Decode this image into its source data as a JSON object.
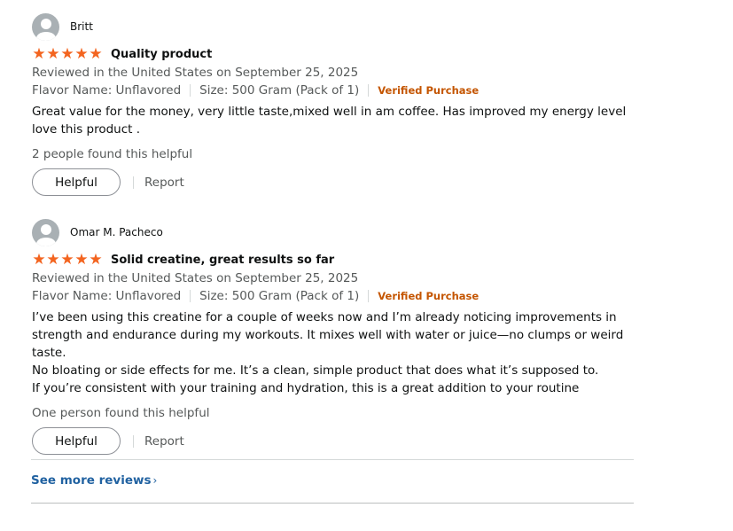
{
  "reviews": [
    {
      "name": "Britt",
      "rating": 5,
      "title": "Quality product",
      "date": "Reviewed in the United States on September 25, 2025",
      "flavor": "Flavor Name: Unflavored",
      "size": "Size: 500 Gram (Pack of 1)",
      "verified": "Verified Purchase",
      "body": [
        "Great value for the money, very little taste,mixed well in am coffee. Has improved my energy level love this product ."
      ],
      "helpful_count": "2 people found this helpful",
      "helpful_label": "Helpful",
      "report_label": "Report"
    },
    {
      "name": "Omar M. Pacheco",
      "rating": 5,
      "title": "Solid creatine, great results so far",
      "date": "Reviewed in the United States on September 25, 2025",
      "flavor": "Flavor Name: Unflavored",
      "size": "Size: 500 Gram (Pack of 1)",
      "verified": "Verified Purchase",
      "body": [
        "I’ve been using this creatine for a couple of weeks now and I’m already noticing improvements in strength and endurance during my workouts. It mixes well with water or juice—no clumps or weird taste.",
        "No bloating or side effects for me. It’s a clean, simple product that does what it’s supposed to.",
        "If you’re consistent with your training and hydration, this is a great addition to your routine"
      ],
      "helpful_count": "One person found this helpful",
      "helpful_label": "Helpful",
      "report_label": "Report"
    }
  ],
  "see_more": "See more reviews",
  "colors": {
    "star": "#f3641f",
    "verified": "#c45500",
    "link": "#2162a1"
  }
}
